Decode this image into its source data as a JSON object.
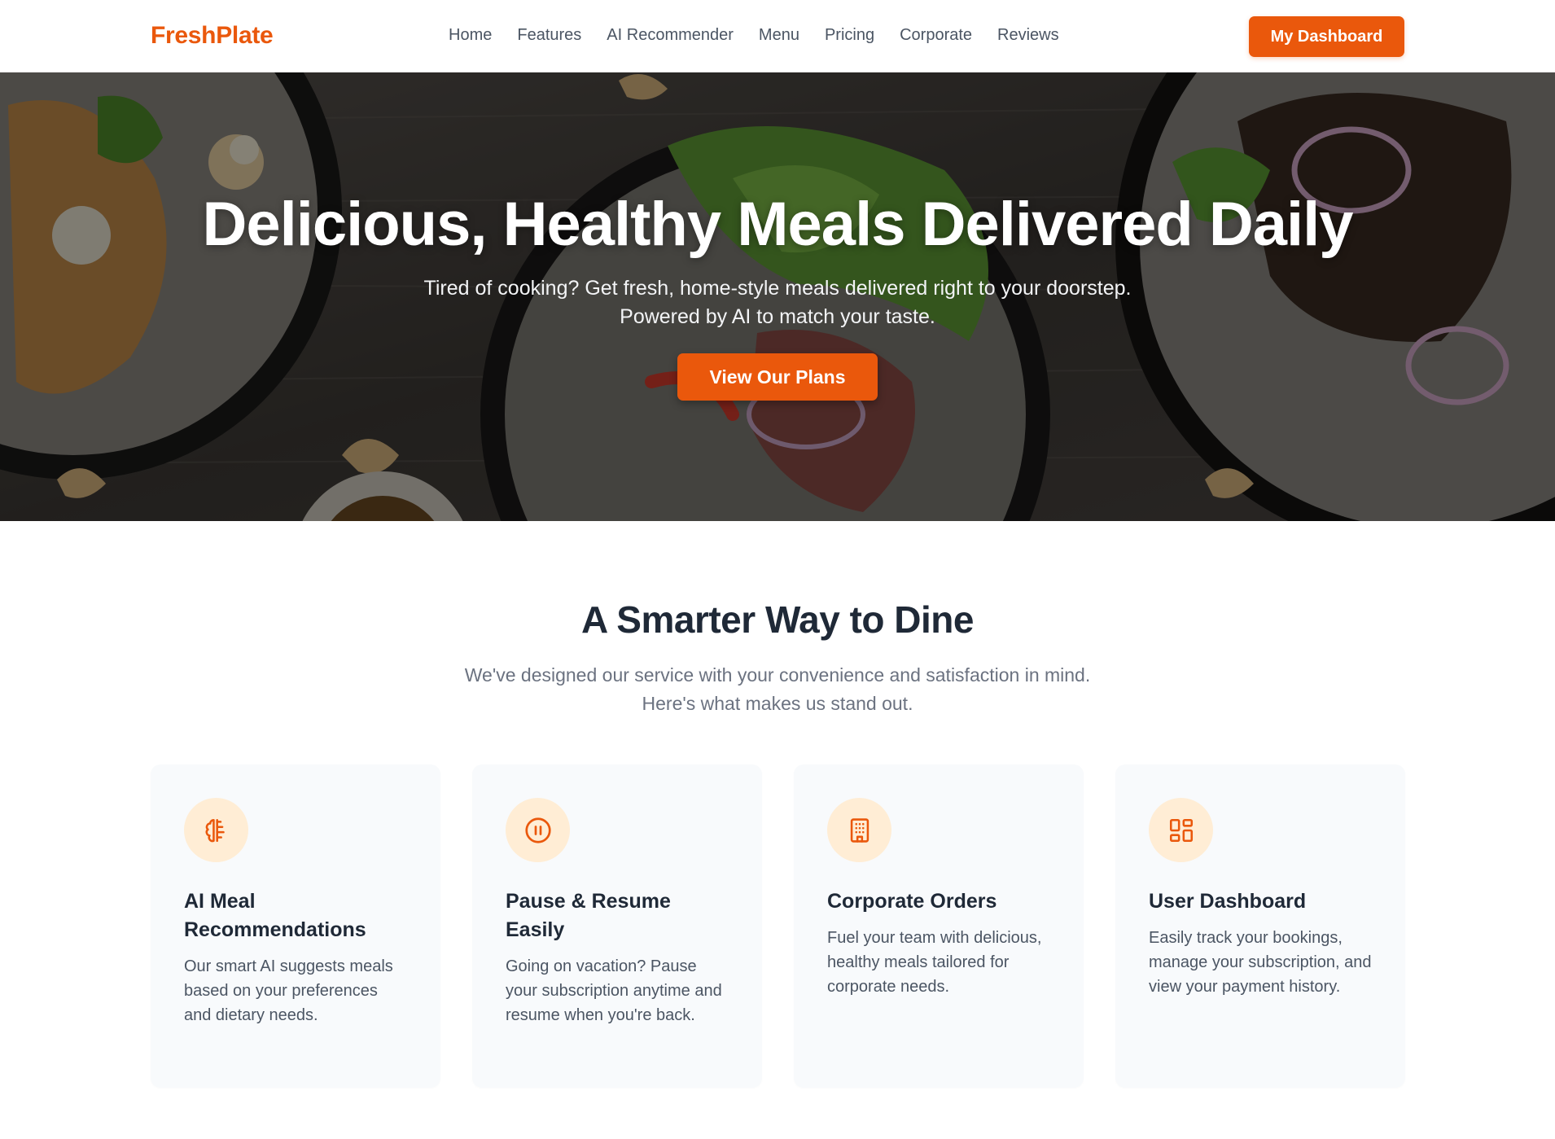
{
  "nav": {
    "logo": "FreshPlate",
    "links": [
      "Home",
      "Features",
      "AI Recommender",
      "Menu",
      "Pricing",
      "Corporate",
      "Reviews"
    ],
    "dashboard_button": "My Dashboard"
  },
  "hero": {
    "title": "Delicious, Healthy Meals Delivered Daily",
    "subtitle_line1": "Tired of cooking? Get fresh, home-style meals delivered right to your doorstep.",
    "subtitle_line2": "Powered by AI to match your taste.",
    "cta": "View Our Plans"
  },
  "features": {
    "title": "A Smarter Way to Dine",
    "subtitle_line1": "We've designed our service with your convenience and satisfaction in mind.",
    "subtitle_line2": "Here's what makes us stand out.",
    "cards": [
      {
        "icon": "brain-icon",
        "title": "AI Meal Recommendations",
        "desc": "Our smart AI suggests meals based on your preferences and dietary needs."
      },
      {
        "icon": "pause-icon",
        "title": "Pause & Resume Easily",
        "desc": "Going on vacation? Pause your subscription anytime and resume when you're back."
      },
      {
        "icon": "building-icon",
        "title": "Corporate Orders",
        "desc": "Fuel your team with delicious, healthy meals tailored for corporate needs."
      },
      {
        "icon": "dashboard-icon",
        "title": "User Dashboard",
        "desc": "Easily track your bookings, manage your subscription, and view your payment history."
      }
    ]
  },
  "colors": {
    "accent": "#ea580c",
    "icon_bg": "#ffedd5",
    "card_bg": "#f8fafc"
  }
}
